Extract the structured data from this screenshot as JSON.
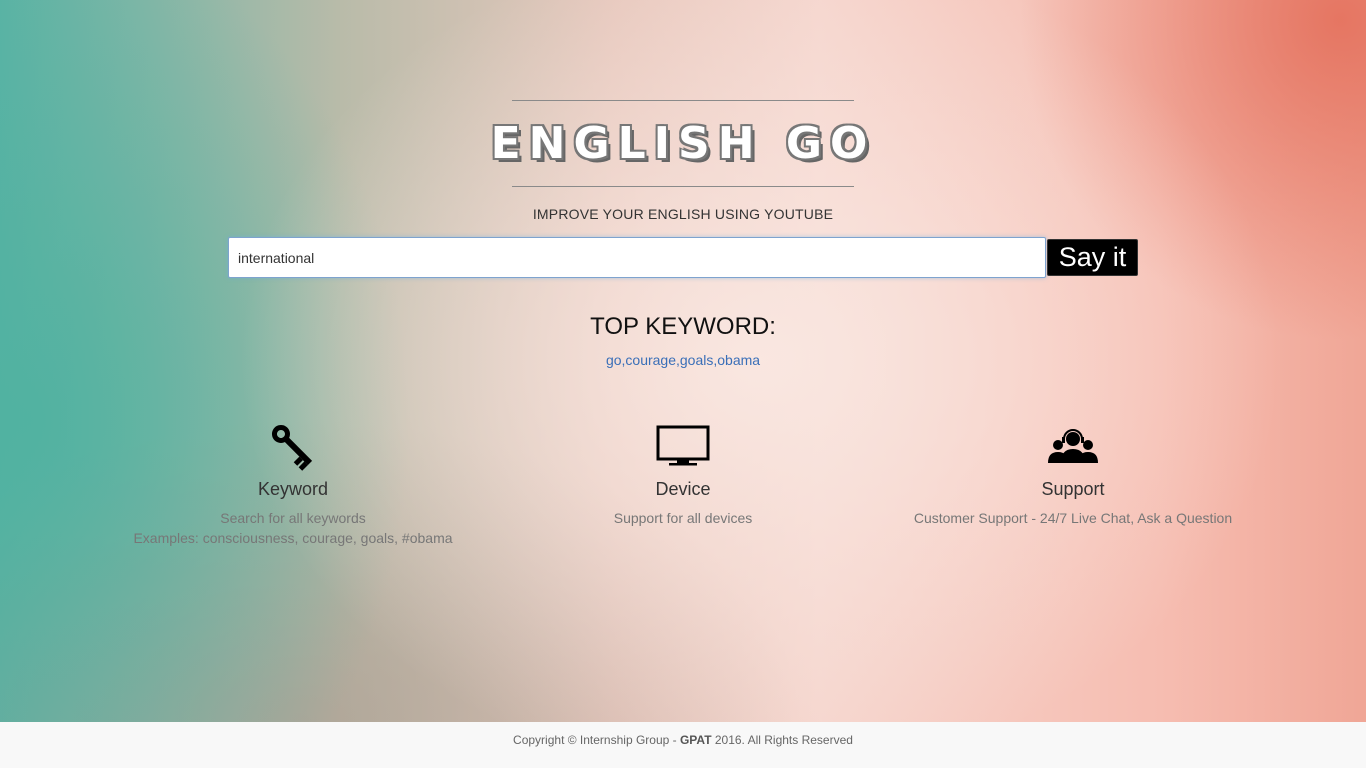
{
  "brand": {
    "title": "ENGLISH GO",
    "tagline": "IMPROVE YOUR ENGLISH USING YOUTUBE"
  },
  "search": {
    "value": "international",
    "button_label": "Say it"
  },
  "top_keywords": {
    "heading": "TOP KEYWORD:",
    "items": [
      "go",
      "courage",
      "goals",
      "obama"
    ],
    "link_color": "#3a6fb8"
  },
  "features": [
    {
      "icon": "key-icon",
      "title": "Keyword",
      "lines": [
        "Search for all keywords",
        "Examples: consciousness, courage, goals, #obama"
      ]
    },
    {
      "icon": "monitor-icon",
      "title": "Device",
      "lines": [
        "Support for all devices"
      ]
    },
    {
      "icon": "support-team-icon",
      "title": "Support",
      "lines": [
        "Customer Support - 24/7 Live Chat, Ask a Question"
      ]
    }
  ],
  "footer": {
    "prefix": "Copyright © Internship Group - ",
    "brand": "GPAT",
    "suffix": " 2016. All Rights Reserved"
  },
  "colors": {
    "button_bg": "#000000",
    "footer_bg": "#f8f8f8"
  }
}
